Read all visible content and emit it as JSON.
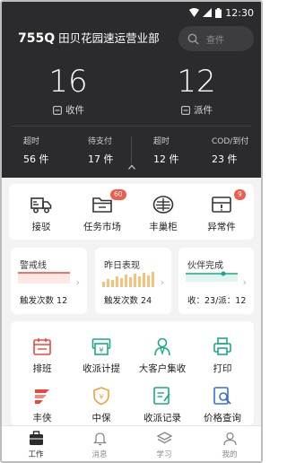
{
  "status_bar": {
    "time": "12:30"
  },
  "header": {
    "station_code": "755Q",
    "station_name": "田贝花园速运营业部",
    "search_placeholder": "查件",
    "receive": {
      "count": "16",
      "label": "收件"
    },
    "deliver": {
      "count": "12",
      "label": "派件"
    },
    "stats": [
      {
        "label": "超时",
        "value": "56 件"
      },
      {
        "label": "待支付",
        "value": "17 件"
      },
      {
        "label": "超时",
        "value": "12 件"
      },
      {
        "label": "COD/到付",
        "value": "23 件"
      }
    ]
  },
  "quick": [
    {
      "label": "接驳",
      "icon": "truck-icon"
    },
    {
      "label": "任务市场",
      "icon": "folder-icon",
      "badge": "60"
    },
    {
      "label": "丰巢柜",
      "icon": "cabinet-icon"
    },
    {
      "label": "异常件",
      "icon": "exception-box-icon",
      "badge": "9"
    }
  ],
  "mini_cards": [
    {
      "title": "警戒线",
      "bottom": "触发次数 12"
    },
    {
      "title": "昨日表现",
      "bottom": "触发次数 24"
    },
    {
      "title": "伙伴完成",
      "bottom": "收：23/派：12"
    }
  ],
  "grid": [
    {
      "label": "排班",
      "icon": "calendar-icon"
    },
    {
      "label": "收派计提",
      "icon": "payment-icon"
    },
    {
      "label": "大客户集收",
      "icon": "customer-icon"
    },
    {
      "label": "打印",
      "icon": "printer-icon"
    },
    {
      "label": "丰侠",
      "icon": "feather-icon"
    },
    {
      "label": "中保",
      "icon": "shield-icon"
    },
    {
      "label": "收派记录",
      "icon": "record-icon"
    },
    {
      "label": "价格查询",
      "icon": "price-search-icon"
    }
  ],
  "nav": [
    {
      "label": "工作",
      "icon": "work-icon",
      "active": true
    },
    {
      "label": "消息",
      "icon": "bell-icon",
      "active": false
    },
    {
      "label": "学习",
      "icon": "study-icon",
      "active": false
    },
    {
      "label": "我的",
      "icon": "profile-icon",
      "active": false
    }
  ],
  "colors": {
    "header_bg": "#2b2b2d",
    "accent_red": "#e8483c",
    "accent_green": "#1ea88a",
    "accent_orange": "#f0a23a",
    "badge": "#f25a4b"
  }
}
